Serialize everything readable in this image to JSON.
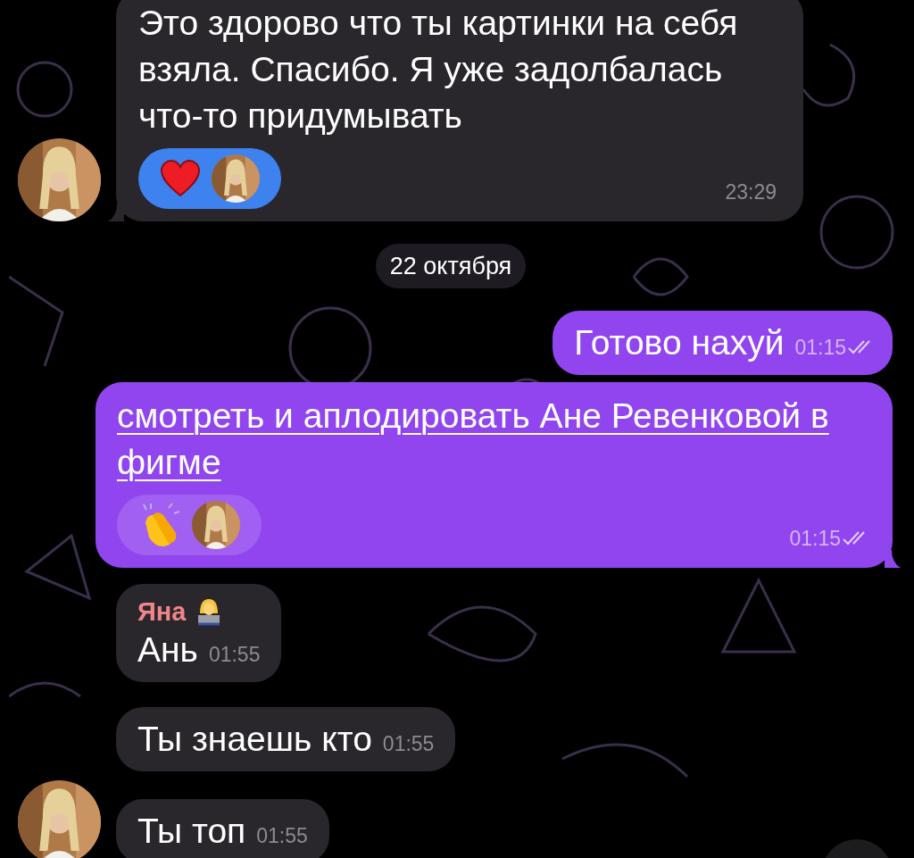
{
  "messages": [
    {
      "kind": "incoming",
      "avatar": true,
      "tail": true,
      "lines": "Это здорово что ты картинки на себя взяла. Спасибо. Я уже задолбалась что-то придумывать",
      "reactions": [
        {
          "kind": "heart"
        },
        {
          "kind": "avatar"
        }
      ],
      "time": "23:29"
    },
    {
      "kind": "date",
      "text": "22 октября"
    },
    {
      "kind": "outgoing",
      "lines": "Готово нахуй",
      "time": "01:15",
      "read": true
    },
    {
      "kind": "outgoing",
      "tail": true,
      "lines": "смотреть и аплодировать Ане Ревенковой в фигме",
      "link": true,
      "reactions": [
        {
          "kind": "clap"
        },
        {
          "kind": "avatar"
        }
      ],
      "time": "01:15",
      "read": true
    },
    {
      "kind": "incoming",
      "sender": "Яна",
      "lines": "Ань",
      "time": "01:55"
    },
    {
      "kind": "incoming",
      "lines": "Ты знаешь кто",
      "time": "01:55"
    },
    {
      "kind": "incoming",
      "avatar": true,
      "lines": "Ты топ",
      "time": "01:55"
    }
  ]
}
